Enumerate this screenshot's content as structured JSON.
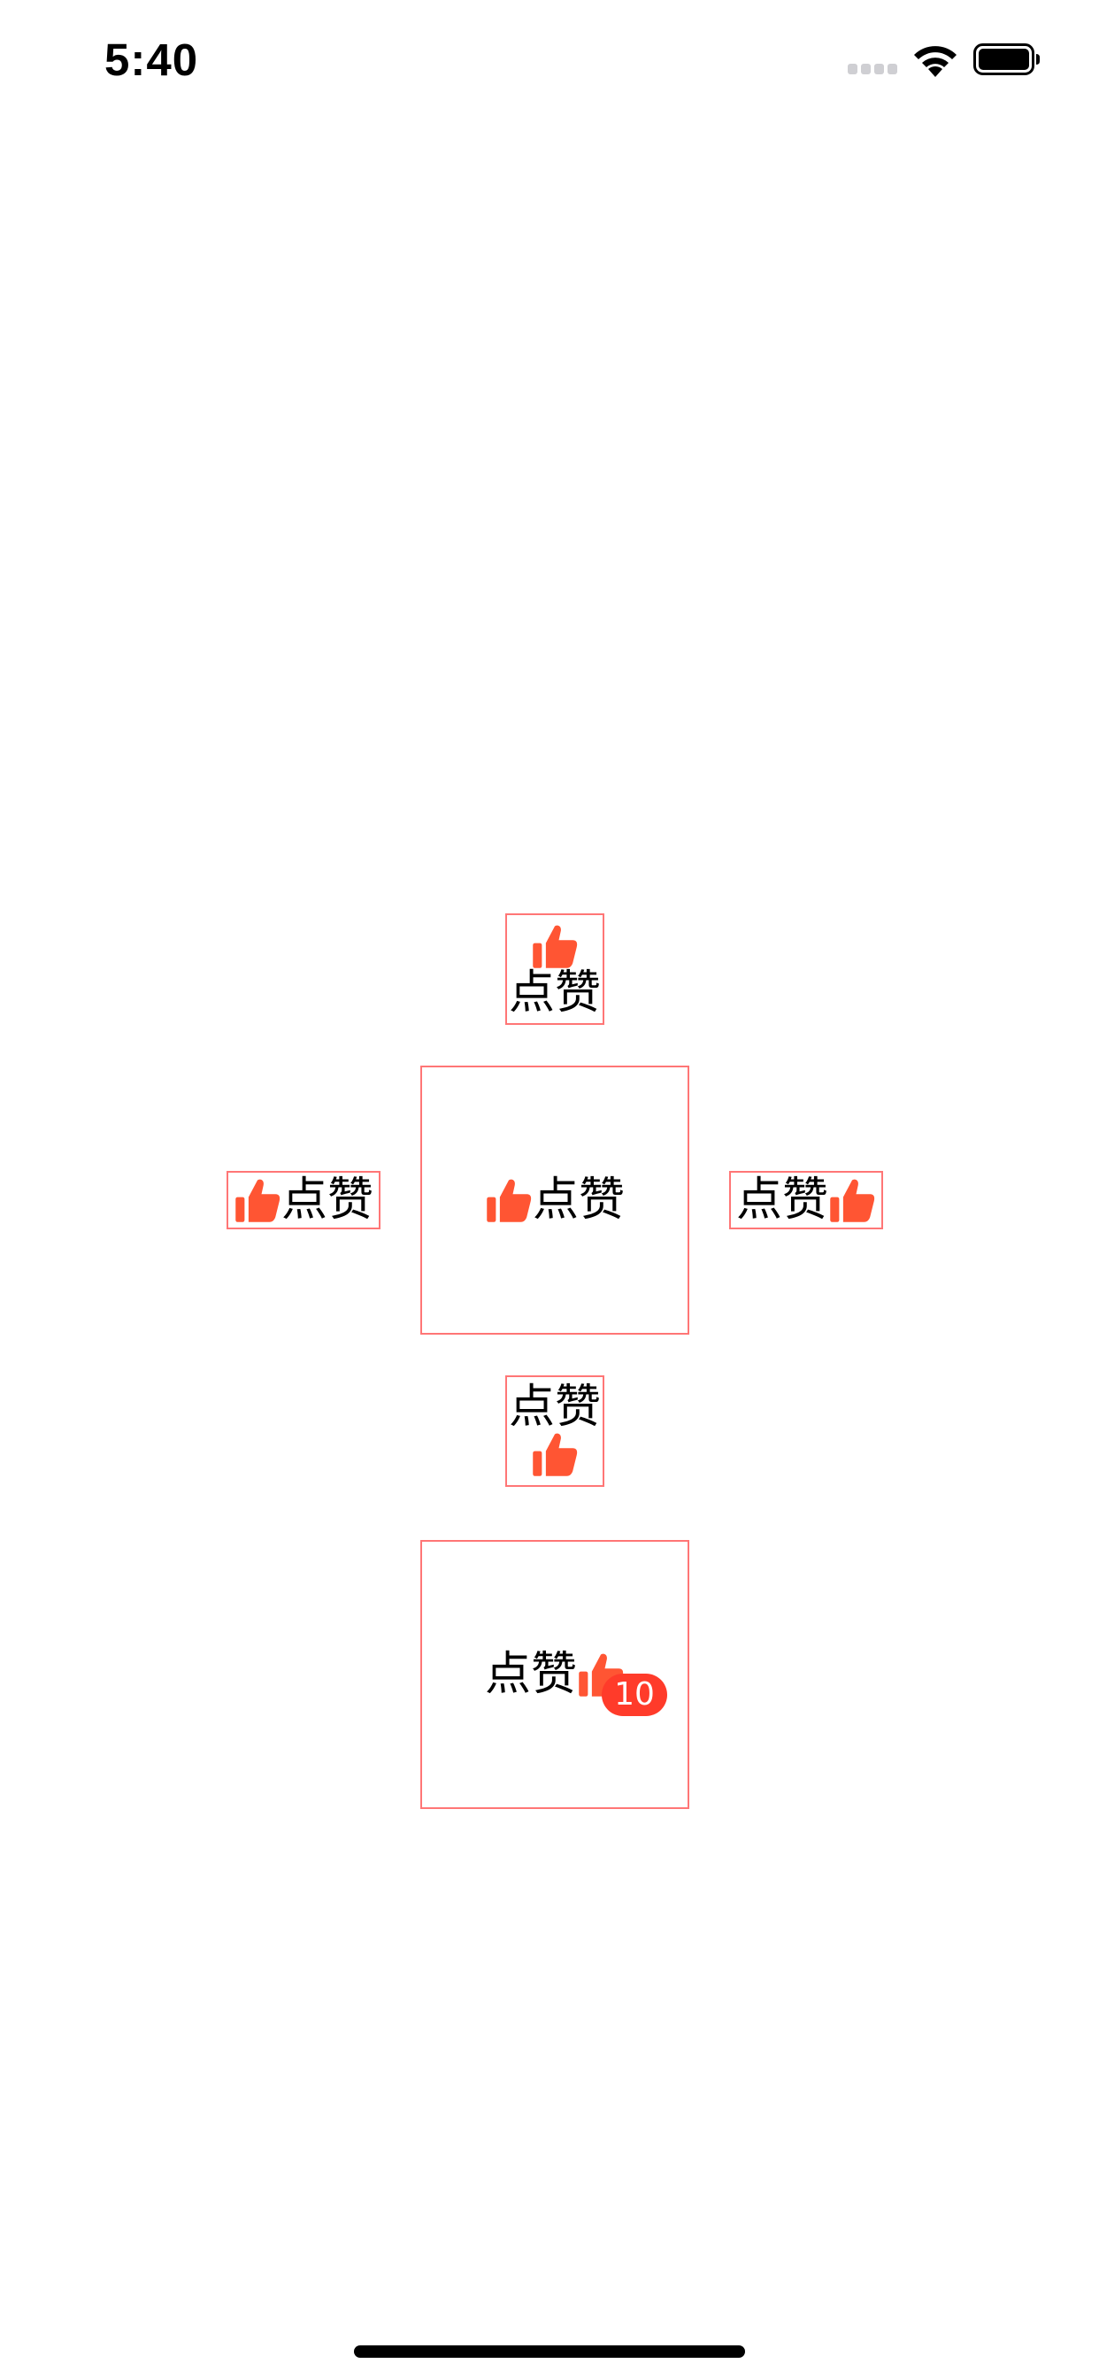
{
  "status_bar": {
    "time": "5:40"
  },
  "colors": {
    "accent": "#ff5533",
    "border": "#ff7676",
    "badge": "#ff3b2a"
  },
  "buttons": {
    "top": {
      "label": "点赞",
      "icon": "thumbs-up-icon",
      "layout": "image-top"
    },
    "left": {
      "label": "点赞",
      "icon": "thumbs-up-icon",
      "layout": "image-left"
    },
    "center": {
      "label": "点赞",
      "icon": "thumbs-up-icon",
      "layout": "image-left"
    },
    "right": {
      "label": "点赞",
      "icon": "thumbs-up-icon",
      "layout": "image-right"
    },
    "bottom": {
      "label": "点赞",
      "icon": "thumbs-up-icon",
      "layout": "image-bottom"
    },
    "badge_button": {
      "label": "点赞",
      "icon": "thumbs-up-icon",
      "layout": "image-right",
      "badge": "10"
    }
  }
}
